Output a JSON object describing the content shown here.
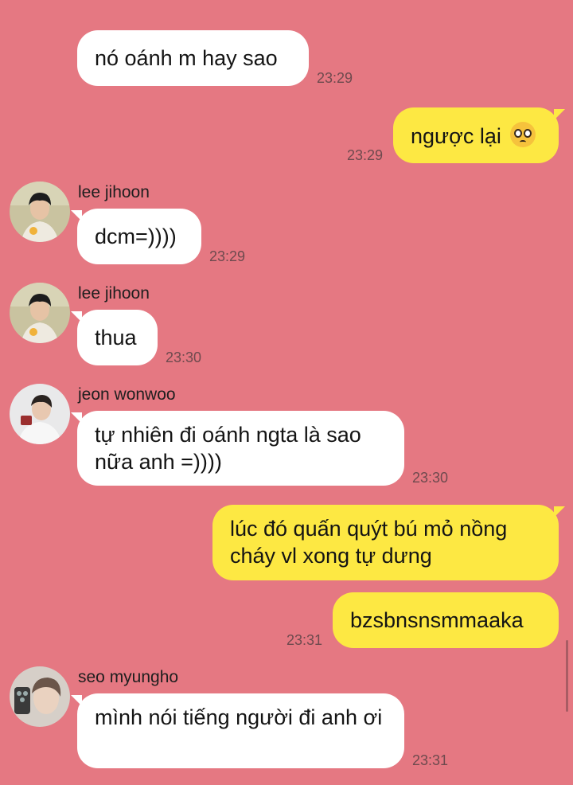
{
  "messages": [
    {
      "text": "nó oánh m hay sao",
      "time": "23:29"
    },
    {
      "text": "ngược lại",
      "time": "23:29",
      "emoji": "pleading-face-emoji"
    },
    {
      "sender": "lee jihoon",
      "text": "dcm=))))",
      "time": "23:29"
    },
    {
      "sender": "lee jihoon",
      "text": "thua",
      "time": "23:30"
    },
    {
      "sender": "jeon wonwoo",
      "text": "tự nhiên đi oánh ngta là sao nữa anh =))))",
      "time": "23:30"
    },
    {
      "text": "lúc đó quấn quýt bú mỏ nồng cháy vl xong tự dưng"
    },
    {
      "text": "bzsbnsnsmmaaka",
      "time": "23:31"
    },
    {
      "sender": "seo myungho",
      "text": "mình nói tiếng người đi anh ơi",
      "time": "23:31"
    }
  ],
  "colors": {
    "background": "#e57882",
    "incoming_bubble": "#ffffff",
    "outgoing_bubble": "#fde843"
  }
}
